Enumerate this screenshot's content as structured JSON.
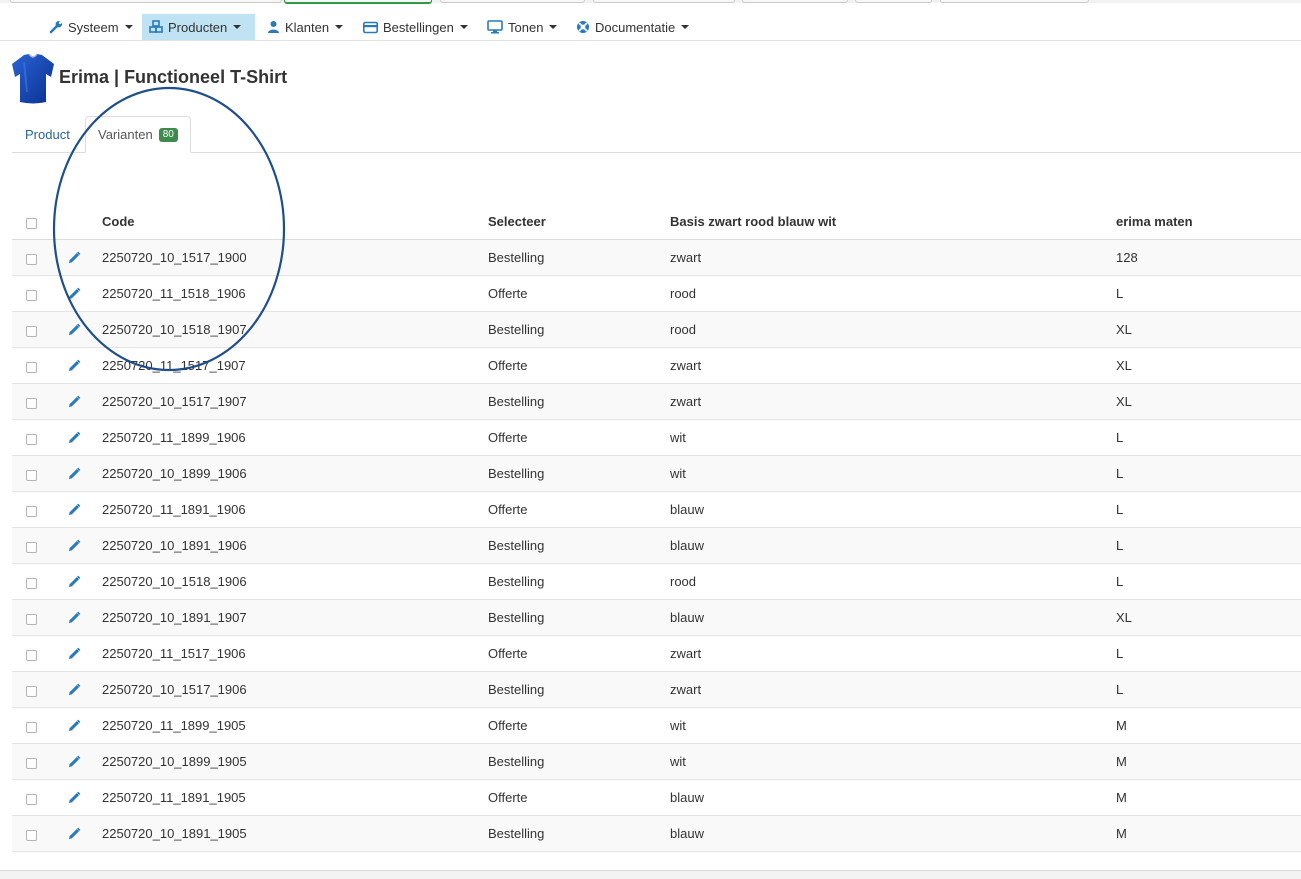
{
  "menu": {
    "items": [
      {
        "label": "Systeem",
        "icon": "wrench-icon"
      },
      {
        "label": "Producten",
        "icon": "cubes-icon",
        "active": true
      },
      {
        "label": "Klanten",
        "icon": "user-icon"
      },
      {
        "label": "Bestellingen",
        "icon": "credit-card-icon"
      },
      {
        "label": "Tonen",
        "icon": "monitor-icon"
      },
      {
        "label": "Documentatie",
        "icon": "lifebuoy-icon"
      }
    ]
  },
  "product": {
    "title": "Erima | Functioneel T-Shirt",
    "image_icon": "tshirt-icon"
  },
  "tabs": {
    "product": "Product",
    "variants": "Varianten",
    "variants_count": "80"
  },
  "table": {
    "headers": {
      "code": "Code",
      "select": "Selecteer",
      "color": "Basis zwart rood blauw wit",
      "size": "erima maten"
    },
    "rows": [
      {
        "code": "2250720_10_1517_1900",
        "select": "Bestelling",
        "color": "zwart",
        "size": "128"
      },
      {
        "code": "2250720_11_1518_1906",
        "select": "Offerte",
        "color": "rood",
        "size": "L"
      },
      {
        "code": "2250720_10_1518_1907",
        "select": "Bestelling",
        "color": "rood",
        "size": "XL"
      },
      {
        "code": "2250720_11_1517_1907",
        "select": "Offerte",
        "color": "zwart",
        "size": "XL"
      },
      {
        "code": "2250720_10_1517_1907",
        "select": "Bestelling",
        "color": "zwart",
        "size": "XL"
      },
      {
        "code": "2250720_11_1899_1906",
        "select": "Offerte",
        "color": "wit",
        "size": "L"
      },
      {
        "code": "2250720_10_1899_1906",
        "select": "Bestelling",
        "color": "wit",
        "size": "L"
      },
      {
        "code": "2250720_11_1891_1906",
        "select": "Offerte",
        "color": "blauw",
        "size": "L"
      },
      {
        "code": "2250720_10_1891_1906",
        "select": "Bestelling",
        "color": "blauw",
        "size": "L"
      },
      {
        "code": "2250720_10_1518_1906",
        "select": "Bestelling",
        "color": "rood",
        "size": "L"
      },
      {
        "code": "2250720_10_1891_1907",
        "select": "Bestelling",
        "color": "blauw",
        "size": "XL"
      },
      {
        "code": "2250720_11_1517_1906",
        "select": "Offerte",
        "color": "zwart",
        "size": "L"
      },
      {
        "code": "2250720_10_1517_1906",
        "select": "Bestelling",
        "color": "zwart",
        "size": "L"
      },
      {
        "code": "2250720_11_1899_1905",
        "select": "Offerte",
        "color": "wit",
        "size": "M"
      },
      {
        "code": "2250720_10_1899_1905",
        "select": "Bestelling",
        "color": "wit",
        "size": "M"
      },
      {
        "code": "2250720_11_1891_1905",
        "select": "Offerte",
        "color": "blauw",
        "size": "M"
      },
      {
        "code": "2250720_10_1891_1905",
        "select": "Bestelling",
        "color": "blauw",
        "size": "M"
      }
    ]
  },
  "colors": {
    "accent": "#2a7ab9",
    "active_menu": "#bfe3f3",
    "badge": "#3f8a4d",
    "annotation": "#1f4f8a"
  }
}
